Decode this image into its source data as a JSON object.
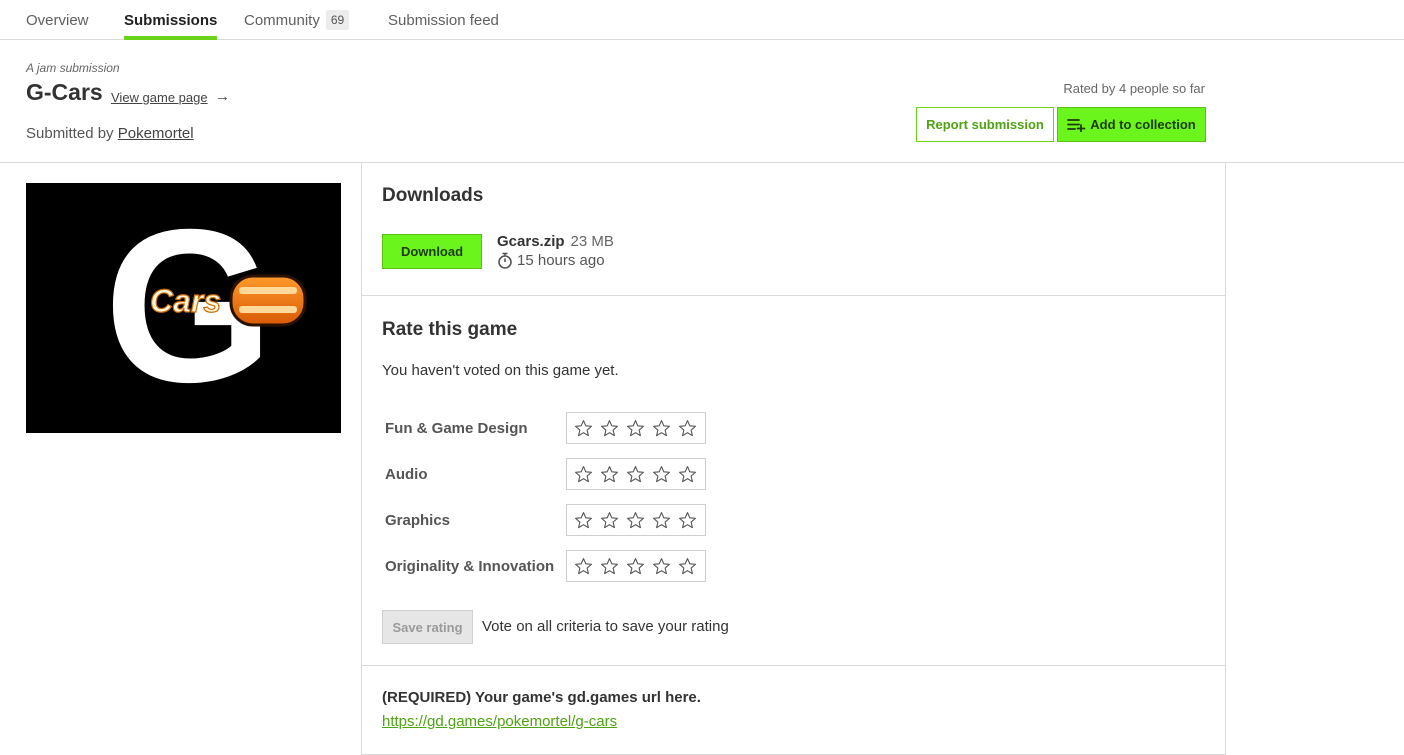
{
  "nav": {
    "tabs": [
      {
        "label": "Overview"
      },
      {
        "label": "Submissions"
      },
      {
        "label": "Community",
        "count": "69"
      },
      {
        "label": "Submission feed"
      }
    ]
  },
  "header": {
    "jam_label": "A jam submission",
    "title": "G-Cars",
    "view_link": "View game page",
    "arrow": "→",
    "submitted_prefix": "Submitted by",
    "author": "Pokemortel",
    "rated_by": "Rated by 4 people so far",
    "report_button": "Report submission",
    "add_button": "Add to collection"
  },
  "cover": {
    "logo_letter": "G",
    "logo_word": "Cars"
  },
  "downloads": {
    "heading": "Downloads",
    "button": "Download",
    "file_name": "Gcars.zip",
    "file_size": "23 MB",
    "uploaded": "15 hours ago"
  },
  "rating": {
    "heading": "Rate this game",
    "note": "You haven't voted on this game yet.",
    "criteria": [
      {
        "label": "Fun & Game Design",
        "stars": 0
      },
      {
        "label": "Audio",
        "stars": 0
      },
      {
        "label": "Graphics",
        "stars": 0
      },
      {
        "label": "Originality & Innovation",
        "stars": 0
      }
    ],
    "save_button": "Save rating",
    "save_hint": "Vote on all criteria to save your rating"
  },
  "required": {
    "label": "(REQUIRED) Your game's gd.games url here.",
    "url": "https://gd.games/pokemortel/g-cars"
  },
  "colors": {
    "accent": "#6cf51d",
    "accent_dark": "#4fa312",
    "logo_orange": "#f07b12"
  }
}
